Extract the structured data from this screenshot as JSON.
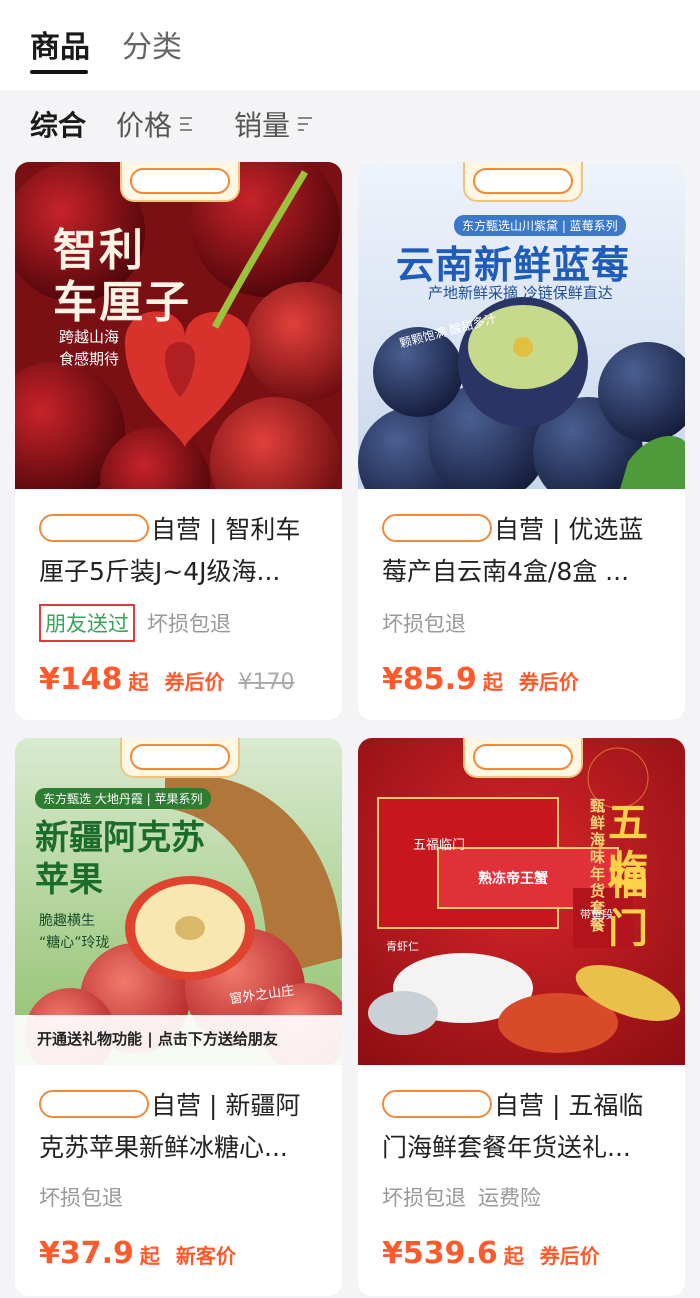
{
  "tabs": [
    {
      "label": "商品",
      "active": true
    },
    {
      "label": "分类",
      "active": false
    }
  ],
  "filters": {
    "comprehensive": "综合",
    "price": "价格",
    "sales": "销量"
  },
  "products": [
    {
      "image": {
        "headline_line1": "智利",
        "headline_line2": "车厘子",
        "sub_line1": "跨越山海",
        "sub_line2": "食感期待"
      },
      "title_prefix": "自营",
      "title_rest": " | 智利车厘子5斤装J~4J级海...",
      "tags": [
        "朋友送过",
        "坏损包退"
      ],
      "price": "¥148",
      "price_suffix": "起",
      "price_note": "券后价",
      "price_old": "¥170"
    },
    {
      "image": {
        "series": "东方甄选山川紫黛 | 蓝莓系列",
        "headline": "云南新鲜蓝莓",
        "sub": "产地新鲜采摘   冷链保鲜直达",
        "script_text": "颗颗饱满  酸甜多汁"
      },
      "title_prefix": "自营",
      "title_rest": " | 优选蓝莓产自云南4盒/8盒 ...",
      "tags": [
        "坏损包退"
      ],
      "price": "¥85.9",
      "price_suffix": "起",
      "price_note": "券后价",
      "price_old": ""
    },
    {
      "image": {
        "series": "东方甄选  大地丹霞 | 苹果系列",
        "headline_line1": "新疆阿克苏",
        "headline_line2": "苹果",
        "sub_line1": "脆趣横生",
        "sub_line2": "“糖心”玲珑",
        "crate_text": "窗外之山庄",
        "bottom_banner": "开通送礼物功能 | 点击下方送给朋友"
      },
      "title_prefix": "自营",
      "title_rest": " | 新疆阿克苏苹果新鲜冰糖心...",
      "tags": [
        "坏损包退"
      ],
      "price": "¥37.9",
      "price_suffix": "起",
      "price_note": "新客价",
      "price_old": ""
    },
    {
      "image": {
        "vertical_label": "甄鲜海味年货套餐",
        "big_line1": "五福",
        "big_line2": "临门",
        "box_label1": "五福临门",
        "box_label2": "熟冻帝王蟹",
        "box_label3": "青虾仁",
        "box_label4": "带鱼段"
      },
      "title_prefix": "自营",
      "title_rest": " | 五福临门海鲜套餐年货送礼...",
      "tags": [
        "坏损包退",
        "运费险"
      ],
      "price": "¥539.6",
      "price_suffix": "起",
      "price_note": "券后价",
      "price_old": ""
    }
  ],
  "colors": {
    "accent_price": "#ff5a2c",
    "mask_outline": "#f08a3a",
    "friend_tag": "#3aa55a",
    "friend_tag_border": "#e03a3a"
  }
}
